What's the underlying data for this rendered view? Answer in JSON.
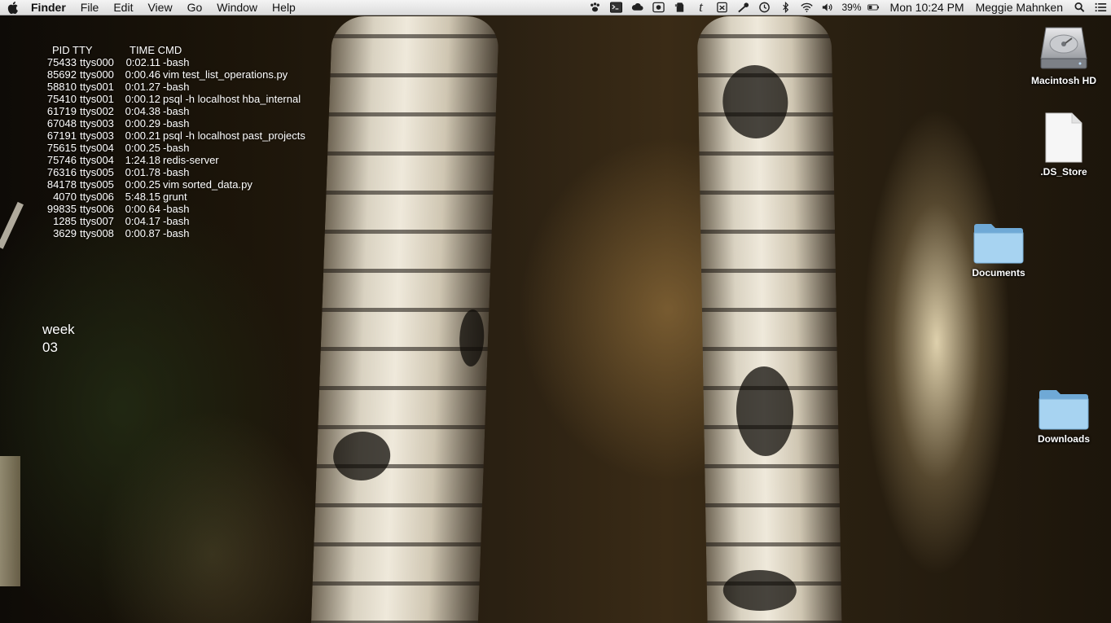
{
  "menubar": {
    "app_name": "Finder",
    "menus": [
      "File",
      "Edit",
      "View",
      "Go",
      "Window",
      "Help"
    ],
    "tray_icons": [
      "paw-icon",
      "terminal-icon",
      "cloud-icon",
      "record-icon",
      "evernote-icon",
      "typewriter-t-icon",
      "clipboard-icon",
      "key-icon",
      "time-machine-icon",
      "bluetooth-icon",
      "wifi-icon",
      "volume-icon"
    ],
    "battery_percent": "39%",
    "clock": "Mon 10:24 PM",
    "user_name": "Meggie Mahnken"
  },
  "ps_widget": {
    "header": {
      "pid_tty": "PID TTY",
      "time_cmd": "TIME CMD"
    },
    "rows": [
      {
        "pid": "75433",
        "tty": "ttys000",
        "time": "0:02.11",
        "cmd": "-bash"
      },
      {
        "pid": "85692",
        "tty": "ttys000",
        "time": "0:00.46",
        "cmd": "vim test_list_operations.py"
      },
      {
        "pid": "58810",
        "tty": "ttys001",
        "time": "0:01.27",
        "cmd": "-bash"
      },
      {
        "pid": "75410",
        "tty": "ttys001",
        "time": "0:00.12",
        "cmd": "psql -h localhost hba_internal"
      },
      {
        "pid": "61719",
        "tty": "ttys002",
        "time": "0:04.38",
        "cmd": "-bash"
      },
      {
        "pid": "67048",
        "tty": "ttys003",
        "time": "0:00.29",
        "cmd": "-bash"
      },
      {
        "pid": "67191",
        "tty": "ttys003",
        "time": "0:00.21",
        "cmd": "psql -h localhost past_projects"
      },
      {
        "pid": "75615",
        "tty": "ttys004",
        "time": "0:00.25",
        "cmd": "-bash"
      },
      {
        "pid": "75746",
        "tty": "ttys004",
        "time": "1:24.18",
        "cmd": "redis-server"
      },
      {
        "pid": "76316",
        "tty": "ttys005",
        "time": "0:01.78",
        "cmd": "-bash"
      },
      {
        "pid": "84178",
        "tty": "ttys005",
        "time": "0:00.25",
        "cmd": "vim sorted_data.py"
      },
      {
        "pid": "4070",
        "tty": "ttys006",
        "time": "5:48.15",
        "cmd": "grunt"
      },
      {
        "pid": "99835",
        "tty": "ttys006",
        "time": "0:00.64",
        "cmd": "-bash"
      },
      {
        "pid": "1285",
        "tty": "ttys007",
        "time": "0:04.17",
        "cmd": "-bash"
      },
      {
        "pid": "3629",
        "tty": "ttys008",
        "time": "0:00.87",
        "cmd": "-bash"
      }
    ]
  },
  "week_widget": {
    "label": "week",
    "number": "03"
  },
  "desktop_icons": [
    {
      "label": "Macintosh HD",
      "icon": "hard-drive-icon"
    },
    {
      "label": ".DS_Store",
      "icon": "document-icon"
    },
    {
      "label": "Documents",
      "icon": "folder-icon"
    },
    {
      "label": "Downloads",
      "icon": "folder-icon"
    }
  ],
  "colors": {
    "menubar_bg": "#e8e8e8",
    "folder_blue": "#8fc3e6",
    "desktop_text": "#ffffff"
  }
}
